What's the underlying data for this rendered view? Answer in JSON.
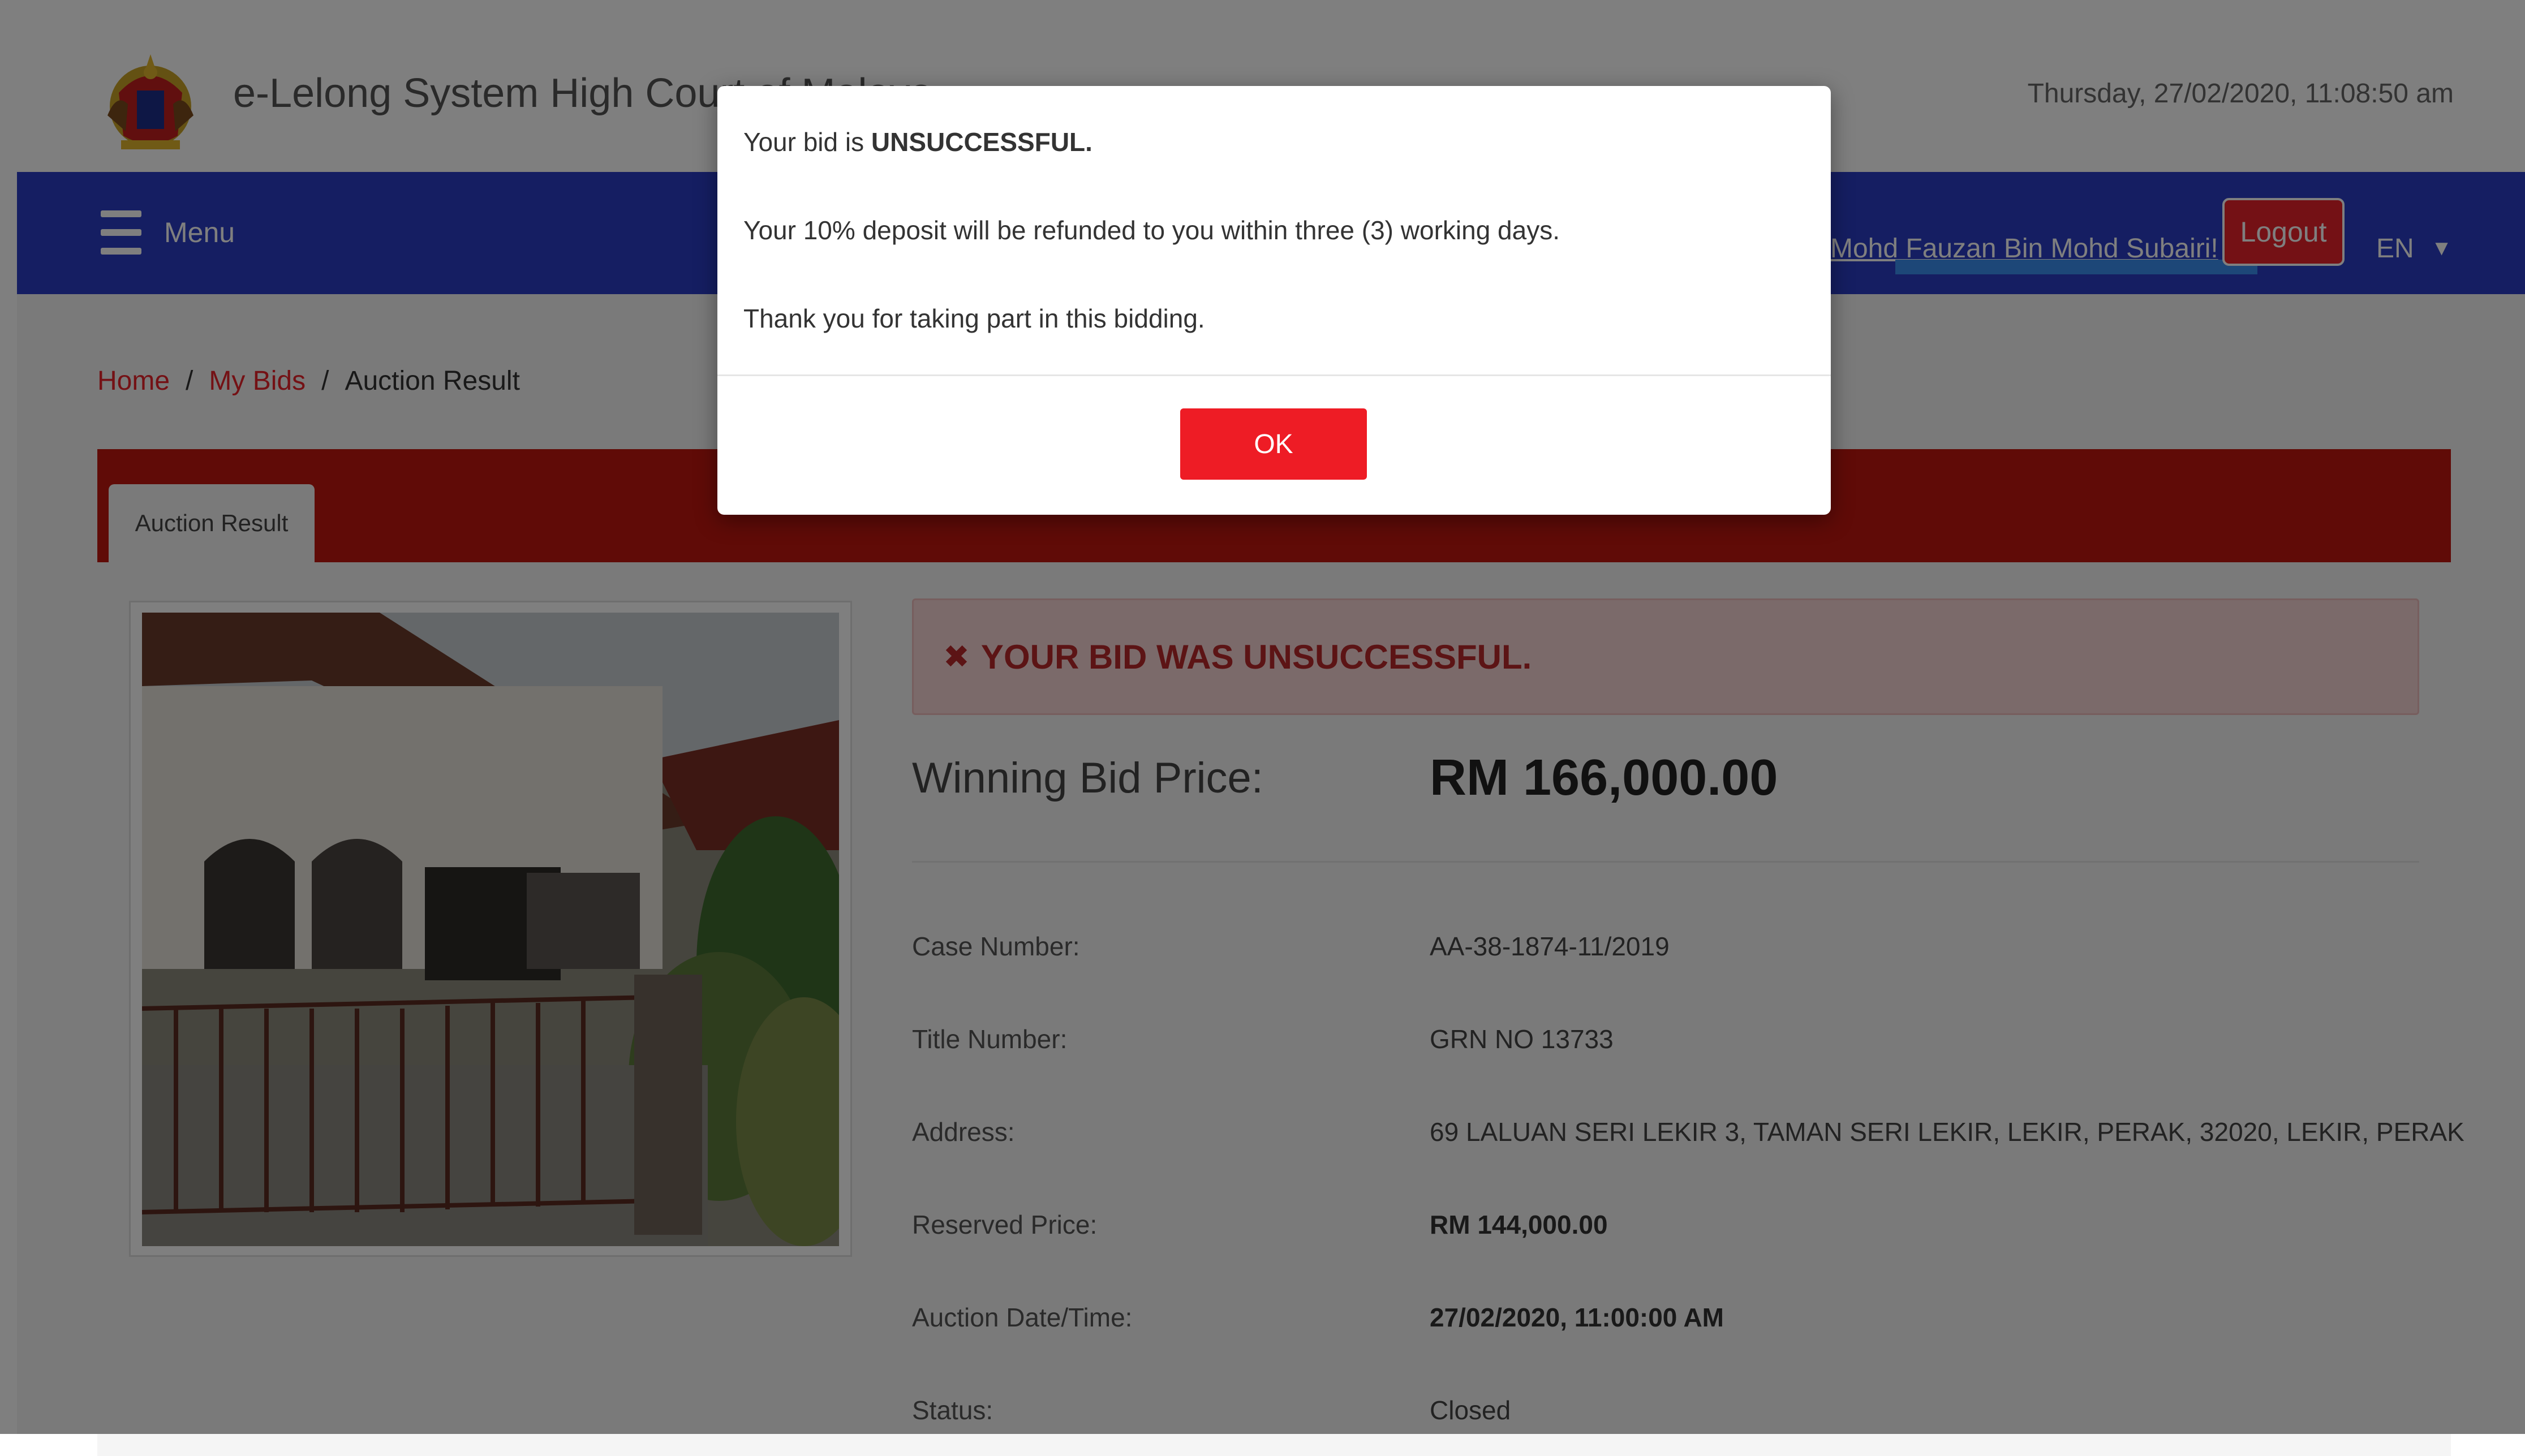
{
  "header": {
    "app_title": "e-Lelong System High Court of Malaya",
    "datetime": "Thursday, 27/02/2020, 11:08:50 am",
    "crest_icon": "coat-of-arms-icon"
  },
  "navbar": {
    "menu_label": "Menu",
    "user_name": "Mohd Fauzan Bin Mohd Subairi!",
    "logout_label": "Logout",
    "language": "EN",
    "bg_color": "#2a3dc5"
  },
  "breadcrumb": {
    "home": "Home",
    "sep1": "/",
    "my_bids": "My Bids",
    "sep2": "/",
    "current": "Auction Result"
  },
  "tabs": [
    {
      "label": "Auction Result",
      "active": true
    }
  ],
  "result": {
    "alert_icon": "✖",
    "alert_text": "YOUR BID WAS UNSUCCESSFUL.",
    "winning_bid_label": "Winning Bid Price:",
    "winning_bid_value": "RM 166,000.00",
    "details": [
      {
        "label": "Case Number:",
        "value": "AA-38-1874-11/2019",
        "bold": false
      },
      {
        "label": "Title Number:",
        "value": "GRN NO 13733",
        "bold": false
      },
      {
        "label": "Address:",
        "value": "69 LALUAN SERI LEKIR 3, TAMAN SERI LEKIR, LEKIR, PERAK, 32020, LEKIR, PERAK",
        "bold": false
      },
      {
        "label": "Reserved Price:",
        "value": "RM 144,000.00",
        "bold": true
      },
      {
        "label": "Auction Date/Time:",
        "value": "27/02/2020, 11:00:00 AM",
        "bold": true
      },
      {
        "label": "Status:",
        "value": "Closed",
        "bold": false
      }
    ]
  },
  "modal": {
    "line1_prefix": "Your bid is ",
    "line1_bold": "UNSUCCESSFUL.",
    "line2": "Your 10% deposit will be refunded to you within three (3) working days.",
    "line3": "Thank you for taking part in this bidding.",
    "ok_label": "OK"
  },
  "colors": {
    "accent_red": "#ee1c25",
    "tab_bar_red": "#c0170f",
    "alert_bg": "#f7d4d4",
    "alert_text": "#b9282b"
  }
}
